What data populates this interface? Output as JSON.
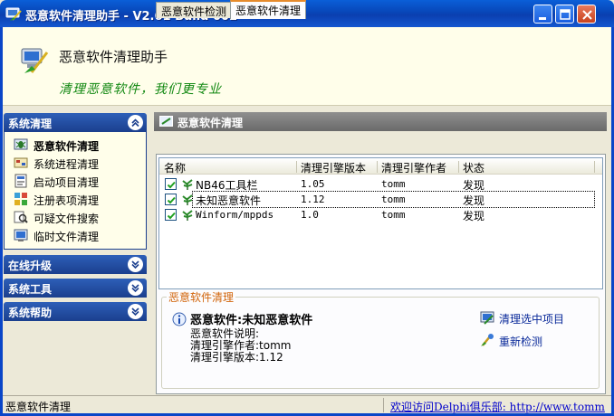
{
  "window": {
    "title": "恶意软件清理助手 - V2.61 Build 002",
    "app_icon": "broom-app-icon",
    "controls": [
      "minimize-icon",
      "maximize-icon",
      "close-icon"
    ]
  },
  "banner": {
    "title": "恶意软件清理助手",
    "slogan": "清理恶意软件，我们更专业",
    "logo_icon": "broom-computer-icon"
  },
  "sidebar": {
    "sections": [
      {
        "label": "系统清理",
        "state": "expanded",
        "icon": "chevron-up-icon"
      },
      {
        "label": "在线升级",
        "state": "collapsed",
        "icon": "chevron-down-icon"
      },
      {
        "label": "系统工具",
        "state": "collapsed",
        "icon": "chevron-down-icon"
      },
      {
        "label": "系统帮助",
        "state": "collapsed",
        "icon": "chevron-down-icon"
      }
    ],
    "items": [
      {
        "label": "恶意软件清理",
        "icon": "bug-icon",
        "active": true
      },
      {
        "label": "系统进程清理",
        "icon": "process-icon",
        "active": false
      },
      {
        "label": "启动项目清理",
        "icon": "startup-icon",
        "active": false
      },
      {
        "label": "注册表项清理",
        "icon": "registry-icon",
        "active": false
      },
      {
        "label": "可疑文件搜索",
        "icon": "search-files-icon",
        "active": false
      },
      {
        "label": "临时文件清理",
        "icon": "temp-files-icon",
        "active": false
      }
    ]
  },
  "main": {
    "header": "恶意软件清理",
    "tabs": [
      {
        "label": "恶意软件检测",
        "active": false
      },
      {
        "label": "恶意软件清理",
        "active": true
      }
    ],
    "list": {
      "columns": [
        "名称",
        "清理引擎版本",
        "清理引擎作者",
        "状态"
      ],
      "rows": [
        {
          "checked": true,
          "name": "NB46工具栏",
          "version": "1.05",
          "author": "tomm",
          "status": "发现"
        },
        {
          "checked": true,
          "name": "未知恶意软件",
          "version": "1.12",
          "author": "tomm",
          "status": "发现"
        },
        {
          "checked": true,
          "name": "Winform/mppds",
          "version": "1.0",
          "author": "tomm",
          "status": "发现"
        }
      ]
    },
    "details": {
      "group_title": "恶意软件清理",
      "title": "恶意软件:未知恶意软件",
      "lines": [
        "恶意软件说明:",
        "清理引擎作者:tomm",
        "清理引擎版本:1.12"
      ],
      "info_icon": "info-icon"
    },
    "actions": [
      {
        "label": "清理选中项目",
        "icon": "clean-icon"
      },
      {
        "label": "重新检测",
        "icon": "rescan-icon"
      }
    ]
  },
  "statusbar": {
    "left": "恶意软件清理",
    "link": "欢迎访问Delphi俱乐部: http://www.tomm"
  },
  "colors": {
    "titlebar": "#0846b8",
    "section_header": "#1b3f8e",
    "banner_bg": "#fffeea",
    "slogan": "#118811",
    "group_title": "#d1640a",
    "link": "#0000cc"
  }
}
